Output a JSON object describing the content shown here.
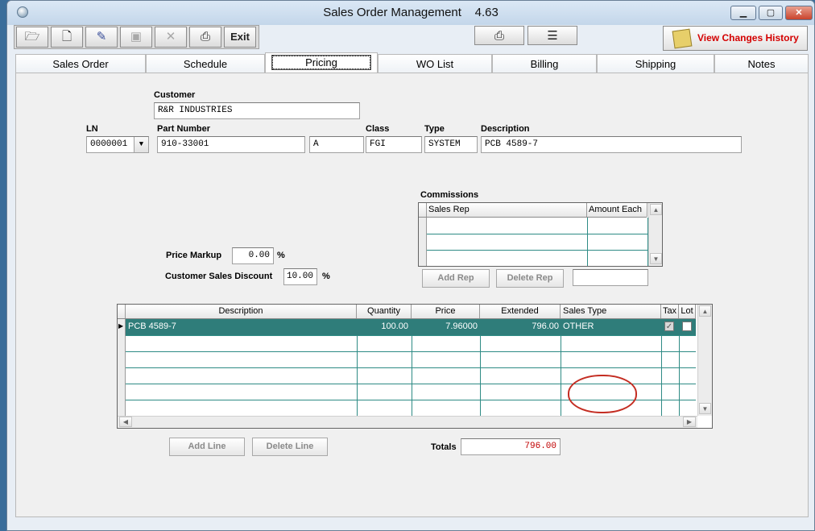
{
  "window": {
    "title": "Sales Order Management    4.63"
  },
  "toolbar": {
    "open_icon": "folder-open-icon",
    "new_icon": "new-document-icon",
    "edit_icon": "edit-icon",
    "save_icon": "save-icon",
    "delete_icon": "delete-x-icon",
    "print_icon": "printer-icon",
    "exit_label": "Exit",
    "view_history_label": "View Changes History"
  },
  "tabs": [
    "Sales Order",
    "Schedule",
    "Pricing",
    "WO List",
    "Billing",
    "Shipping",
    "Notes"
  ],
  "active_tab": "Pricing",
  "form": {
    "customer_label": "Customer",
    "customer_value": "R&R INDUSTRIES",
    "ln_label": "LN",
    "ln_value": "0000001",
    "part_label": "Part Number",
    "part_value": "910-33001",
    "rev_value": "A",
    "class_label": "Class",
    "class_value": "FGI",
    "type_label": "Type",
    "type_value": "SYSTEM",
    "desc_label": "Description",
    "desc_value": "PCB 4589-7",
    "markup_label": "Price Markup",
    "markup_value": "0.00",
    "markup_unit": "%",
    "discount_label": "Customer Sales Discount",
    "discount_value": "10.00",
    "discount_unit": "%"
  },
  "commissions": {
    "title": "Commissions",
    "col_rep": "Sales Rep",
    "col_amount": "Amount Each",
    "add_rep": "Add Rep",
    "delete_rep": "Delete Rep",
    "rep_input_value": ""
  },
  "lines": {
    "columns": [
      "Description",
      "Quantity",
      "Price",
      "Extended",
      "Sales Type",
      "Tax",
      "Lot"
    ],
    "rows": [
      {
        "description": "PCB 4589-7",
        "quantity": "100.00",
        "price": "7.96000",
        "extended": "796.00",
        "sales_type": "OTHER",
        "tax": true,
        "lot": false
      }
    ],
    "add_line": "Add Line",
    "delete_line": "Delete Line"
  },
  "totals": {
    "label": "Totals",
    "value": "796.00"
  },
  "colors": {
    "selected_row": "#2f7d7a",
    "history_text": "#d40000",
    "totals_text": "#c00000",
    "annotation": "#c42d22"
  }
}
